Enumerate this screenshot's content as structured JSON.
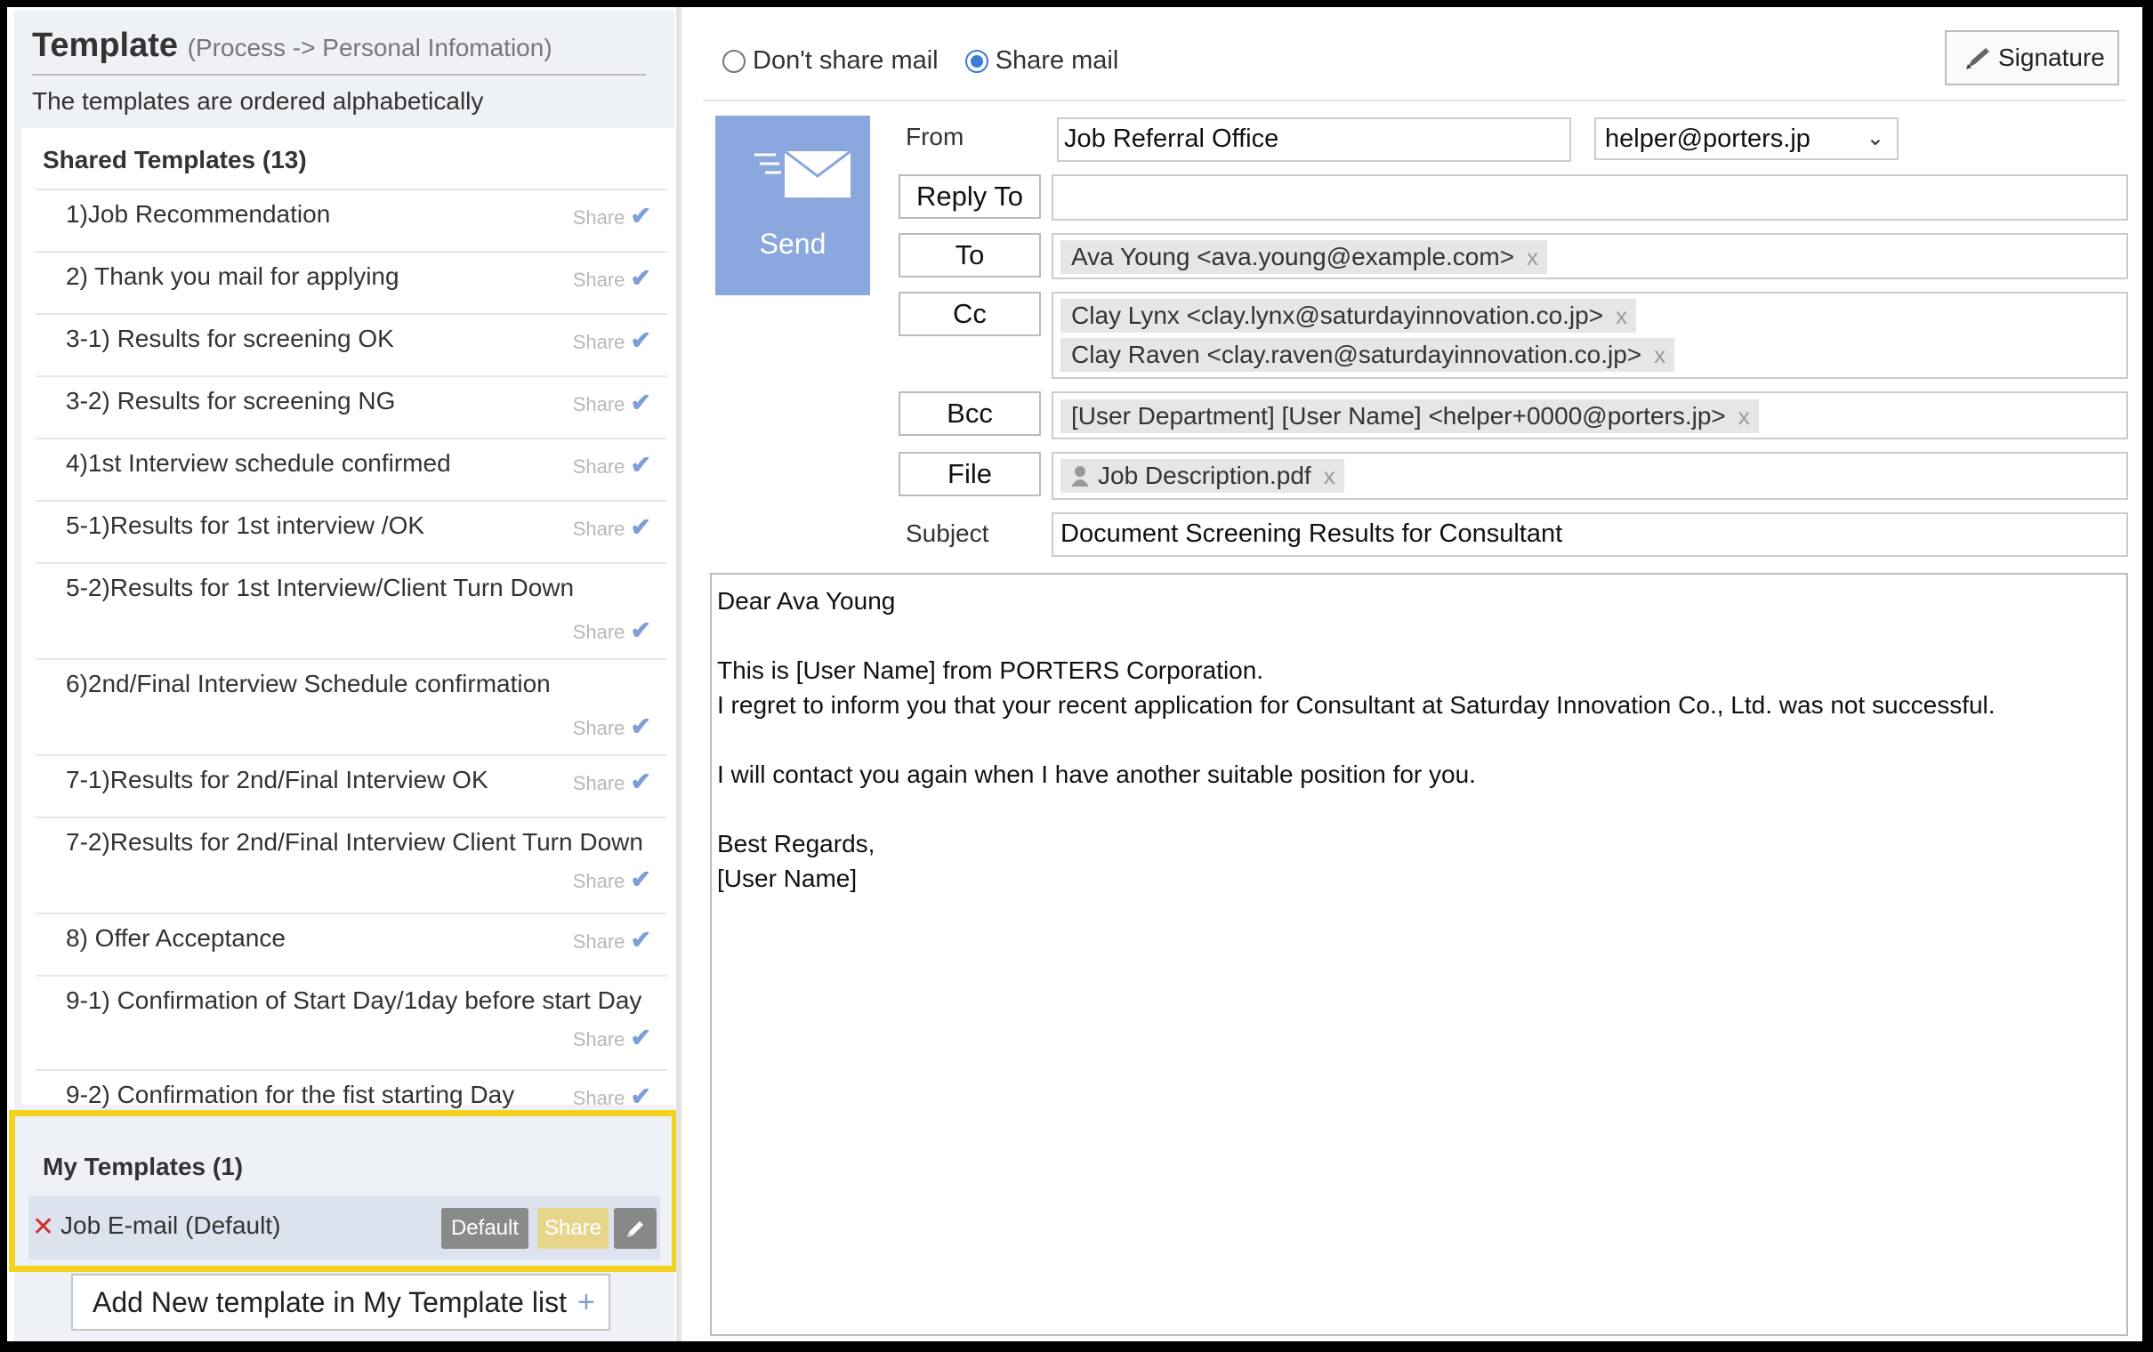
{
  "template_panel": {
    "title": "Template",
    "subtitle": "(Process -> Personal Infomation)",
    "note": "The templates are ordered alphabetically",
    "shared_title": "Shared Templates (13)",
    "share_label": "Share",
    "shared_templates": [
      {
        "name": "1)Job Recommendation"
      },
      {
        "name": "2) Thank you mail for applying"
      },
      {
        "name": "3-1) Results for screening OK"
      },
      {
        "name": "3-2) Results for screening NG"
      },
      {
        "name": "4)1st Interview schedule confirmed"
      },
      {
        "name": "5-1)Results for 1st interview /OK"
      },
      {
        "name": "5-2)Results for 1st Interview/Client Turn Down"
      },
      {
        "name": "6)2nd/Final Interview Schedule confirmation"
      },
      {
        "name": "7-1)Results for 2nd/Final Interview OK"
      },
      {
        "name": "7-2)Results for 2nd/Final Interview Client Turn Down"
      },
      {
        "name": "8) Offer Acceptance"
      },
      {
        "name": "9-1) Confirmation of Start Day/1day before start Day"
      },
      {
        "name": "9-2) Confirmation for the fist starting Day"
      }
    ],
    "my_title": "My Templates (1)",
    "my_templates": [
      {
        "name": "Job E-mail (Default)",
        "default_label": "Default",
        "share_label": "Share"
      }
    ],
    "add_label": "Add New template in My Template list",
    "add_icon": "+",
    "highlight_color": "#f4d220"
  },
  "compose": {
    "share_options": [
      {
        "label": "Don't share mail",
        "selected": false
      },
      {
        "label": "Share mail",
        "selected": true
      }
    ],
    "signature_label": "Signature",
    "send_label": "Send",
    "from_label": "From",
    "from_name": "Job Referral Office",
    "from_address": "helper@porters.jp",
    "reply_to_label": "Reply To",
    "to_label": "To",
    "to": [
      "Ava Young <ava.young@example.com>"
    ],
    "cc_label": "Cc",
    "cc": [
      "Clay Lynx <clay.lynx@saturdayinnovation.co.jp>",
      "Clay Raven <clay.raven@saturdayinnovation.co.jp>"
    ],
    "bcc_label": "Bcc",
    "bcc": [
      "[User Department] [User Name] <helper+0000@porters.jp>"
    ],
    "file_label": "File",
    "files": [
      "Job Description.pdf"
    ],
    "subject_label": "Subject",
    "subject": "Document Screening Results for Consultant",
    "remove_icon": "x",
    "body_lines": [
      "Dear Ava Young",
      "",
      "This is [User Name] from PORTERS Corporation.",
      "I regret to inform you that your recent application for  Consultant at Saturday Innovation Co., Ltd. was not successful.",
      "",
      "I will contact you again when I have another suitable position for you.",
      "",
      "Best Regards,",
      "[User Name]"
    ],
    "accent_color": "#8aa8de"
  }
}
